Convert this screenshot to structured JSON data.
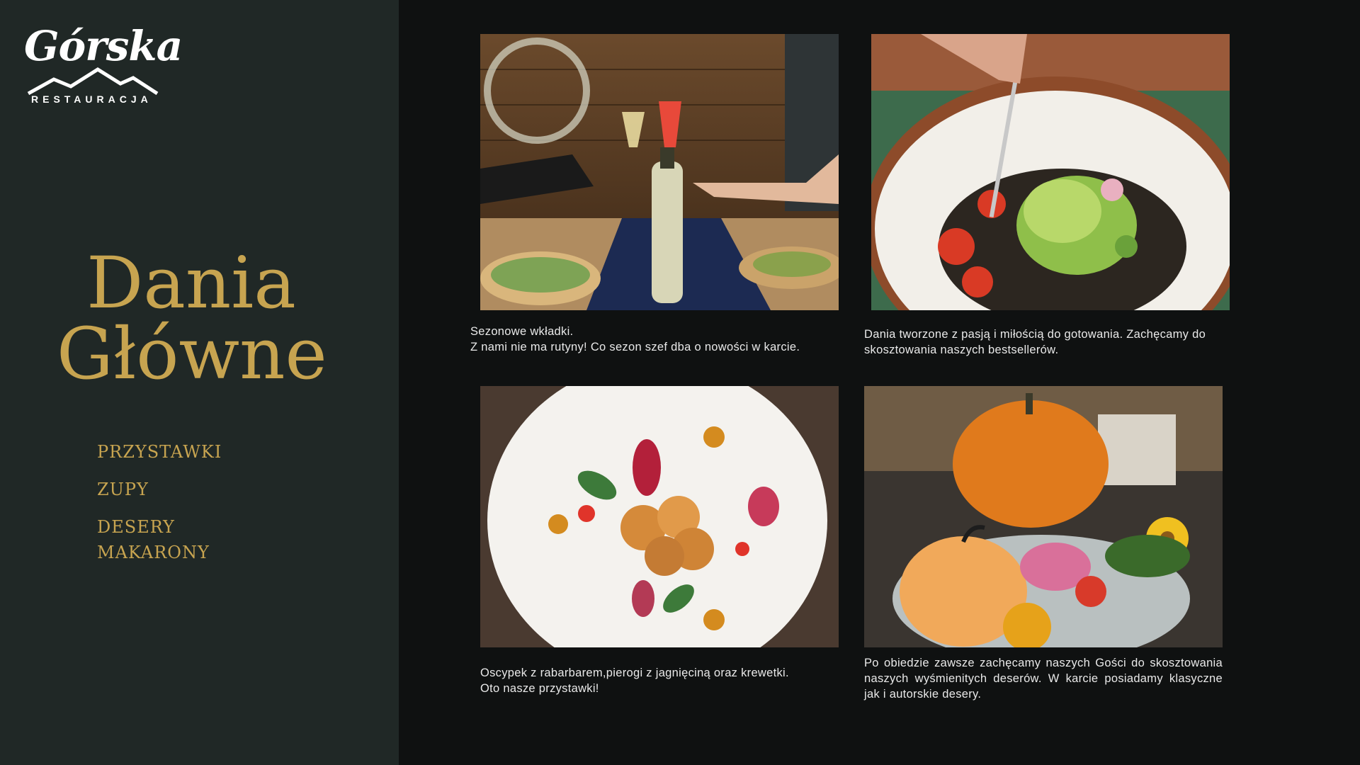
{
  "brand": {
    "logo_script": "Górska",
    "logo_sub": "RESTAURACJA"
  },
  "title": {
    "line1": "Dania",
    "line2": "Główne"
  },
  "nav": [
    {
      "label": "PRZYSTAWKI"
    },
    {
      "label": "ZUPY"
    },
    {
      "label": "DESERY"
    },
    {
      "label": "MAKARONY"
    }
  ],
  "cards": [
    {
      "caption_line1": "Sezonowe wkładki.",
      "caption_line2": "Z nami nie ma rutyny! Co sezon szef dba o nowości  w karcie."
    },
    {
      "caption": "Dania tworzone z pasją i miłością do gotowania. Zachęcamy do skosztowania naszych bestsellerów."
    },
    {
      "caption_line1": "Oscypek z rabarbarem,pierogi z jagnięciną oraz krewetki.",
      "caption_line2": "Oto nasze przystawki!"
    },
    {
      "caption": "Po obiedzie zawsze zachęcamy naszych Gości do skosztowania naszych wyśmienitych deserów. W karcie posiadamy klasyczne jak i autorskie desery."
    }
  ],
  "colors": {
    "sidebar": "#202826",
    "main": "#0f1111",
    "accent_gold": "#c7a450",
    "caption_text": "#e9e9e9"
  }
}
